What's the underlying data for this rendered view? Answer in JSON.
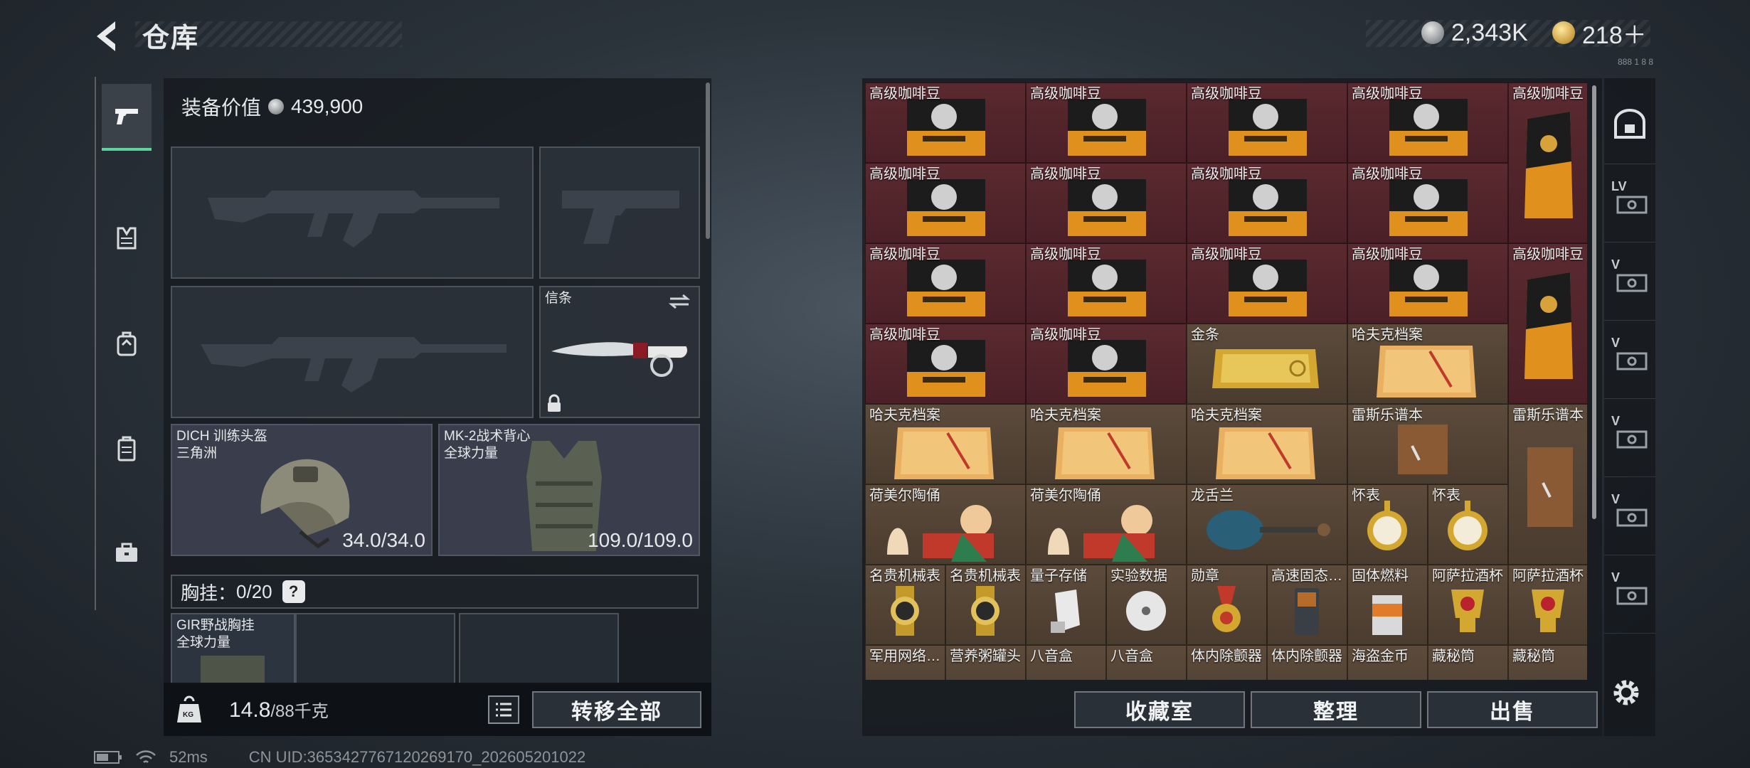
{
  "header": {
    "title": "仓库",
    "currencies": [
      {
        "name": "silver-coin",
        "value": "2,343K"
      },
      {
        "name": "gold-coin",
        "value": "218＋"
      }
    ],
    "tiny_label": "888 1 8 8"
  },
  "left_tabs": [
    {
      "icon": "pistol-icon",
      "active": true
    },
    {
      "icon": "vest-icon",
      "active": false
    },
    {
      "icon": "backpack-icon",
      "active": false
    },
    {
      "icon": "container-icon",
      "active": false
    },
    {
      "icon": "briefcase-icon",
      "active": false
    }
  ],
  "equipment": {
    "value_label": "装备价值",
    "value": "439,900",
    "melee": {
      "label": "信条"
    },
    "helmet": {
      "name": "DICH 训练头盔",
      "faction": "三角洲",
      "durability": "34.0/34.0"
    },
    "armor": {
      "name": "MK-2战术背心",
      "faction": "全球力量",
      "durability": "109.0/109.0"
    },
    "chest_rig": {
      "label": "胸挂：",
      "count": "0/20",
      "help": "?"
    },
    "rig_item": {
      "name": "GIR野战胸挂",
      "faction": "全球力量"
    },
    "weight": {
      "current": "14.8",
      "max": "/88千克",
      "icon_label": "KG"
    },
    "transfer_all": "转移全部"
  },
  "stash": {
    "rows": [
      [
        "高级咖啡豆",
        "高级咖啡豆",
        "高级咖啡豆",
        "高级咖啡豆"
      ],
      [
        "高级咖啡豆",
        "高级咖啡豆",
        "高级咖啡豆",
        "高级咖啡豆"
      ],
      [
        "高级咖啡豆",
        "高级咖啡豆",
        "高级咖啡豆",
        "高级咖啡豆"
      ],
      [
        "高级咖啡豆",
        "高级咖啡豆",
        "金条",
        "哈夫克档案"
      ],
      [
        "哈夫克档案",
        "哈夫克档案",
        "哈夫克档案",
        "雷斯乐谱本"
      ],
      [
        "荷美尔陶俑",
        "荷美尔陶俑",
        "龙舌兰",
        "怀表",
        "怀表"
      ],
      [
        "名贵机械表",
        "名贵机械表",
        "量子存储",
        "实验数据",
        "勋章",
        "高速固态…",
        "固体燃料",
        "阿萨拉酒杯",
        "阿萨拉酒杯"
      ],
      [
        "军用网络…",
        "营养粥罐头",
        "八音盒",
        "八音盒",
        "体内除颤器",
        "体内除颤器",
        "海盗金币",
        "藏秘筒",
        "藏秘筒"
      ]
    ],
    "tall_items": [
      "高级咖啡豆",
      "高级咖啡豆",
      "雷斯乐谱本"
    ],
    "buttons": {
      "collection": "收藏室",
      "organize": "整理",
      "sell": "出售"
    }
  },
  "side_rail": [
    {
      "icon": "safe-box-icon",
      "label": ""
    },
    {
      "icon": "stash-tab-icon",
      "label": "LV"
    },
    {
      "icon": "stash-tab-icon",
      "label": "V"
    },
    {
      "icon": "stash-tab-icon",
      "label": "V"
    },
    {
      "icon": "stash-tab-icon",
      "label": "V"
    },
    {
      "icon": "stash-tab-icon",
      "label": "V"
    },
    {
      "icon": "stash-tab-icon",
      "label": "V"
    }
  ],
  "status": {
    "ping": "52ms",
    "uid": "CN UID:3653427767120269170_202605201022"
  },
  "colors": {
    "accent_green": "#5fd39b",
    "rare_red": "#5a2a30",
    "brown": "#5c4b3b"
  }
}
